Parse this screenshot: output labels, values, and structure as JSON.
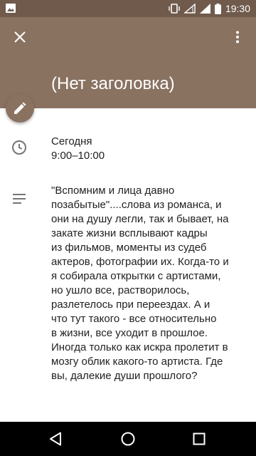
{
  "status_bar": {
    "time": "19:30",
    "icons": [
      "gallery-icon",
      "vibrate-icon",
      "wifi-icon",
      "signal-icon",
      "battery-icon"
    ]
  },
  "header": {
    "title": "(Нет заголовка)",
    "close_icon": "close-icon",
    "more_icon": "more-vert-icon",
    "background_color": "#8a7261"
  },
  "fab": {
    "icon": "edit-pencil-icon"
  },
  "event": {
    "date": "Сегодня",
    "time_range": "9:00–10:00",
    "time_icon": "clock-icon",
    "description_icon": "notes-icon",
    "description": "\"Вспомним и лица давно\nпозабытые\"....слова из романса,  и\nони на душу легли, так и бывает, на\nзакате жизни всплывают кадры\nиз фильмов, моменты из судеб\nактеров, фотографии их. Когда-то и\nя собирала открытки с артистами,\nно ушло все, растворилось,\nразлетелось при переездах. А и\nчто тут такого - все относительно\nв жизни, все уходит в прошлое.\nИногда только как искра пролетит в\nмозгу облик какого-то артиста. Где\nвы, далекие души прошлого?"
  },
  "nav_bar": {
    "back_icon": "back-triangle-icon",
    "home_icon": "home-circle-icon",
    "recents_icon": "recents-square-icon"
  }
}
